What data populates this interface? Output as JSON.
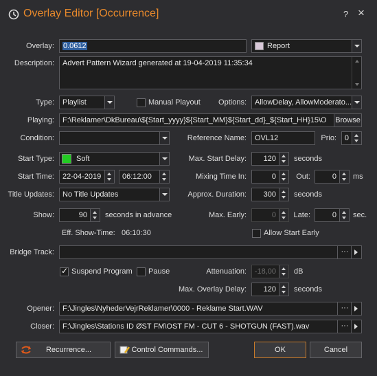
{
  "window": {
    "title": "Overlay Editor [Occurrence]",
    "help_label": "?",
    "close_label": "×"
  },
  "overlay": {
    "label": "Overlay:",
    "value": "0.0612",
    "category": "Report",
    "category_color": "#d8c8d8"
  },
  "description": {
    "label": "Description:",
    "value": "Advert Pattern Wizard generated at 19-04-2019 11:35:34"
  },
  "type": {
    "label": "Type:",
    "value": "Playlist"
  },
  "manual_playout": {
    "label": "Manual Playout",
    "checked": false
  },
  "options": {
    "label": "Options:",
    "value": "AllowDelay, AllowModerato..."
  },
  "playing": {
    "label": "Playing:",
    "value": "F:\\Reklamer\\DkBureau\\${Start_yyyy}${Start_MM}${Start_dd}_${Start_HH}15\\O",
    "browse": "Browse"
  },
  "condition": {
    "label": "Condition:",
    "value": ""
  },
  "reference_name": {
    "label": "Reference Name:",
    "value": "OVL12"
  },
  "prio": {
    "label": "Prio:",
    "value": "0"
  },
  "start_type": {
    "label": "Start Type:",
    "value": "Soft",
    "color": "#22cc22"
  },
  "max_start_delay": {
    "label": "Max. Start Delay:",
    "value": "120",
    "unit": "seconds"
  },
  "start_time": {
    "label": "Start Time:",
    "date": "22-04-2019",
    "time": "06:12:00"
  },
  "mixing_time_in": {
    "label": "Mixing Time In:",
    "value": "0"
  },
  "out": {
    "label": "Out:",
    "value": "0",
    "unit": "ms"
  },
  "title_updates": {
    "label": "Title Updates:",
    "value": "No Title Updates"
  },
  "approx_duration": {
    "label": "Approx. Duration:",
    "value": "300",
    "unit": "seconds"
  },
  "show": {
    "label": "Show:",
    "value": "90",
    "unit": "seconds in advance"
  },
  "max_early": {
    "label": "Max. Early:",
    "value": "0"
  },
  "late": {
    "label": "Late:",
    "value": "0",
    "unit": "sec."
  },
  "eff_show_time": {
    "label": "Eff. Show-Time:",
    "value": "06:10:30"
  },
  "allow_start_early": {
    "label": "Allow Start Early",
    "checked": false
  },
  "bridge_track": {
    "label": "Bridge Track:",
    "value": ""
  },
  "suspend_program": {
    "label": "Suspend Program",
    "checked": true
  },
  "pause": {
    "label": "Pause",
    "checked": false
  },
  "attenuation": {
    "label": "Attenuation:",
    "value": "-18,00",
    "unit": "dB"
  },
  "max_overlay_delay": {
    "label": "Max. Overlay Delay:",
    "value": "120",
    "unit": "seconds"
  },
  "opener": {
    "label": "Opener:",
    "value": "F:\\Jingles\\NyhederVejrReklamer\\0000 - Reklame Start.WAV"
  },
  "closer": {
    "label": "Closer:",
    "value": "F:\\Jingles\\Stations ID ØST FM\\OST FM - CUT 6 - SHOTGUN (FAST).wav"
  },
  "buttons": {
    "recurrence": "Recurrence...",
    "control_commands": "Control Commands...",
    "ok": "OK",
    "cancel": "Cancel"
  },
  "colors": {
    "accent": "#e8892b",
    "background": "#2d2d30",
    "field": "#1e1e1e"
  }
}
